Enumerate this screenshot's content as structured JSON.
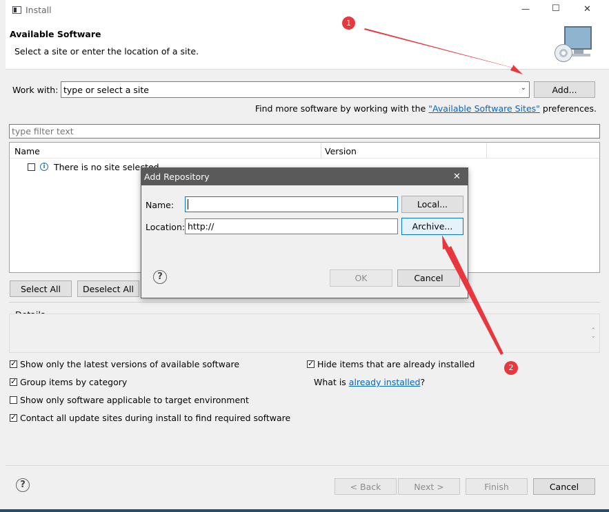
{
  "window": {
    "title": "Install",
    "minimize_glyph": "—",
    "maximize_glyph": "☐",
    "close_glyph": "✕"
  },
  "header": {
    "title": "Available Software",
    "subtitle": "Select a site or enter the location of a site."
  },
  "work_with": {
    "label": "Work with:",
    "value": "type or select a site",
    "add_label": "Add..."
  },
  "more_software": {
    "prefix": "Find more software by working with the ",
    "link": "\"Available Software Sites\"",
    "suffix": " preferences."
  },
  "filter": {
    "placeholder": "type filter text"
  },
  "table": {
    "columns": [
      "Name",
      "Version"
    ],
    "rows": [
      {
        "text": "There is no site selected."
      }
    ]
  },
  "selection_buttons": {
    "select_all": "Select All",
    "deselect_all": "Deselect All"
  },
  "details": {
    "label": "Details"
  },
  "options": {
    "left": [
      {
        "label": "Show only the latest versions of available software",
        "checked": true
      },
      {
        "label": "Group items by category",
        "checked": true
      },
      {
        "label": "Show only software applicable to target environment",
        "checked": false
      },
      {
        "label": "Contact all update sites during install to find required software",
        "checked": true
      }
    ],
    "hide_installed": {
      "label": "Hide items that are already installed",
      "checked": true
    },
    "what_is": {
      "prefix": "What is ",
      "link": "already installed",
      "suffix": "?"
    }
  },
  "footer": {
    "back": "< Back",
    "next": "Next >",
    "finish": "Finish",
    "cancel": "Cancel"
  },
  "dialog": {
    "title": "Add Repository",
    "name_label": "Name:",
    "name_value": "",
    "location_label": "Location:",
    "location_value": "http://",
    "local_label": "Local...",
    "archive_label": "Archive...",
    "ok_label": "OK",
    "cancel_label": "Cancel"
  },
  "annotations": [
    {
      "number": "1"
    },
    {
      "number": "2"
    }
  ],
  "colors": {
    "annotation_red": "#e8373d",
    "link_blue": "#0066cc",
    "dialog_title_bg": "#5a5a5a"
  }
}
